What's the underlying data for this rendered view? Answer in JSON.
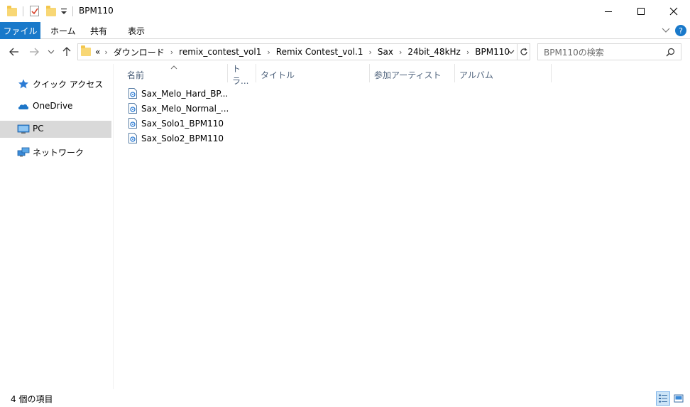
{
  "window": {
    "title": "BPM110"
  },
  "ribbon": {
    "tabs": [
      {
        "label": "ファイル",
        "active": true
      },
      {
        "label": "ホーム"
      },
      {
        "label": "共有"
      },
      {
        "label": "表示"
      }
    ]
  },
  "address": {
    "overflow": "«",
    "crumbs": [
      "ダウンロード",
      "remix_contest_vol1",
      "Remix Contest_vol.1",
      "Sax",
      "24bit_48kHz",
      "BPM110"
    ]
  },
  "search": {
    "placeholder": "BPM110の検索"
  },
  "nav": {
    "items": [
      {
        "label": "クイック アクセス",
        "icon": "star-icon"
      },
      {
        "label": "OneDrive",
        "icon": "cloud-icon"
      },
      {
        "label": "PC",
        "icon": "computer-icon",
        "selected": true
      },
      {
        "label": "ネットワーク",
        "icon": "network-icon"
      }
    ]
  },
  "columns": [
    "名前",
    "トラ...",
    "タイトル",
    "参加アーティスト",
    "アルバム"
  ],
  "files": [
    {
      "name": "Sax_Melo_Hard_BP..."
    },
    {
      "name": "Sax_Melo_Normal_..."
    },
    {
      "name": "Sax_Solo1_BPM110"
    },
    {
      "name": "Sax_Solo2_BPM110"
    }
  ],
  "status": {
    "item_count": "4 個の項目"
  },
  "colors": {
    "accent": "#1979ca",
    "selection": "#d9d9d9",
    "folder": "#f8d775"
  }
}
